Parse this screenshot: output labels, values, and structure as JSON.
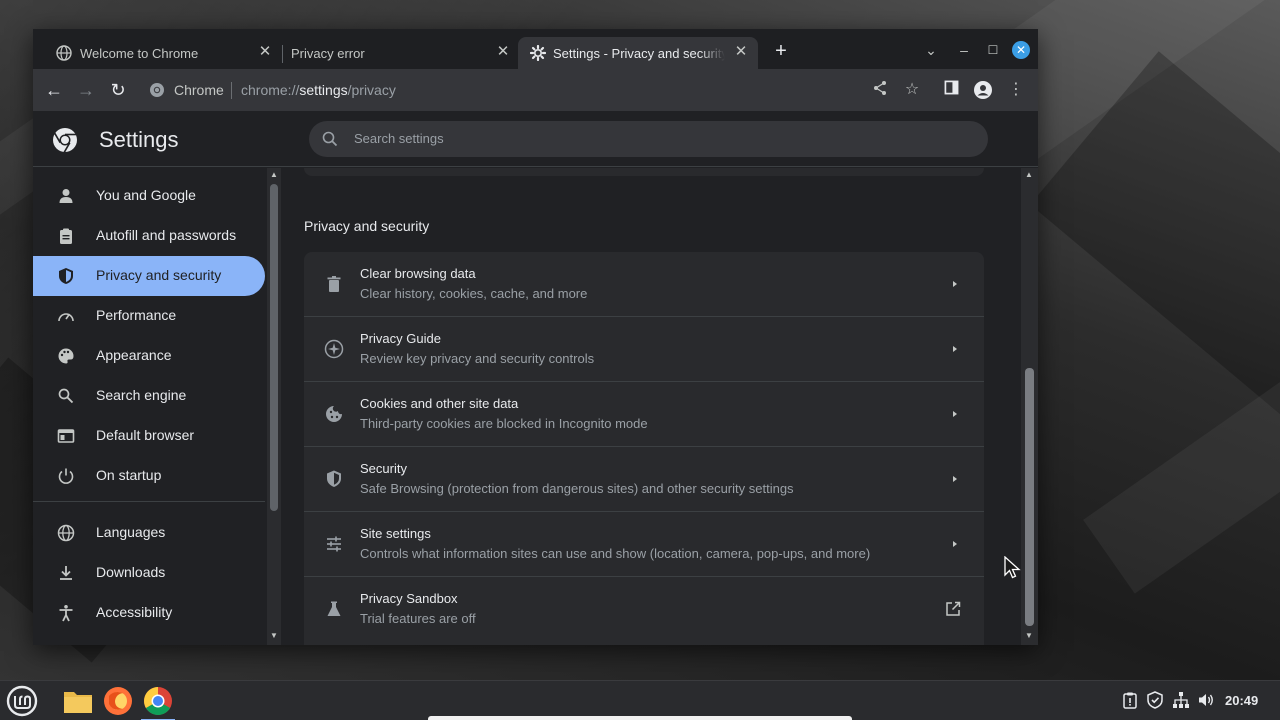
{
  "tabs": [
    {
      "title": "Welcome to Chrome",
      "favicon": "globe-icon"
    },
    {
      "title": "Privacy error",
      "favicon": "none"
    },
    {
      "title": "Settings - Privacy and security",
      "favicon": "gear-icon",
      "active": true
    }
  ],
  "toolbar": {
    "omnibox_label": "Chrome",
    "url_prefix": "chrome://",
    "url_host": "settings",
    "url_path": "/privacy"
  },
  "settings": {
    "title": "Settings",
    "search_placeholder": "Search settings",
    "sidebar": [
      {
        "label": "You and Google",
        "icon": "person-icon"
      },
      {
        "label": "Autofill and passwords",
        "icon": "clipboard-icon"
      },
      {
        "label": "Privacy and security",
        "icon": "shield-icon",
        "active": true
      },
      {
        "label": "Performance",
        "icon": "speedometer-icon"
      },
      {
        "label": "Appearance",
        "icon": "palette-icon"
      },
      {
        "label": "Search engine",
        "icon": "search-icon"
      },
      {
        "label": "Default browser",
        "icon": "browser-icon"
      },
      {
        "label": "On startup",
        "icon": "power-icon"
      },
      {
        "label": "Languages",
        "icon": "globe-icon"
      },
      {
        "label": "Downloads",
        "icon": "download-icon"
      },
      {
        "label": "Accessibility",
        "icon": "accessibility-icon"
      }
    ],
    "section_title": "Privacy and security",
    "rows": [
      {
        "title": "Clear browsing data",
        "subtitle": "Clear history, cookies, cache, and more",
        "icon": "trash-icon",
        "action": "arrow"
      },
      {
        "title": "Privacy Guide",
        "subtitle": "Review key privacy and security controls",
        "icon": "compass-icon",
        "action": "arrow"
      },
      {
        "title": "Cookies and other site data",
        "subtitle": "Third-party cookies are blocked in Incognito mode",
        "icon": "cookie-icon",
        "action": "arrow"
      },
      {
        "title": "Security",
        "subtitle": "Safe Browsing (protection from dangerous sites) and other security settings",
        "icon": "shield-icon",
        "action": "arrow"
      },
      {
        "title": "Site settings",
        "subtitle": "Controls what information sites can use and show (location, camera, pop-ups, and more)",
        "icon": "sliders-icon",
        "action": "arrow"
      },
      {
        "title": "Privacy Sandbox",
        "subtitle": "Trial features are off",
        "icon": "flask-icon",
        "action": "external-link"
      }
    ]
  },
  "taskbar": {
    "apps": [
      "mint-menu-icon",
      "folder-icon",
      "firefox-icon",
      "chrome-icon"
    ],
    "tray": [
      "clipboard-icon",
      "shield-icon",
      "network-icon",
      "volume-icon"
    ],
    "clock": "20:49"
  },
  "colors": {
    "accent": "#8ab4f8",
    "page_bg": "#202124",
    "card_bg": "#292a2d",
    "toolbar_bg": "#35363a"
  }
}
